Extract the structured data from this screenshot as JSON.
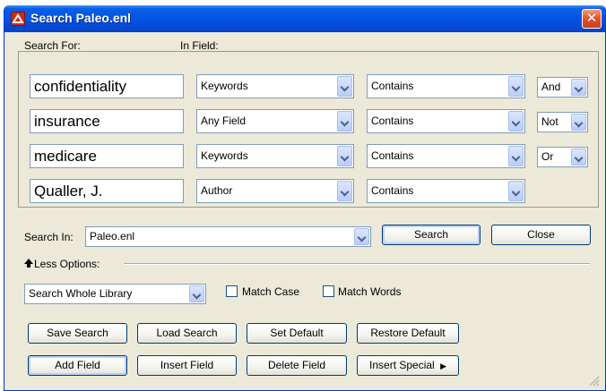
{
  "window": {
    "title": "Search Paleo.enl"
  },
  "headers": {
    "search_for": "Search For:",
    "in_field": "In Field:"
  },
  "rows": [
    {
      "term": "confidentiality",
      "field": "Keywords",
      "op": "Contains",
      "bool": "And"
    },
    {
      "term": "insurance",
      "field": "Any Field",
      "op": "Contains",
      "bool": "Not"
    },
    {
      "term": "medicare",
      "field": "Keywords",
      "op": "Contains",
      "bool": "Or"
    },
    {
      "term": "Qualler, J.",
      "field": "Author",
      "op": "Contains",
      "bool": ""
    }
  ],
  "search_in": {
    "label": "Search In:",
    "value": "Paleo.enl"
  },
  "actions": {
    "search": "Search",
    "close": "Close"
  },
  "options": {
    "toggle_label": "Less Options:",
    "scope": "Search Whole Library",
    "match_case": "Match Case",
    "match_words": "Match Words",
    "match_case_checked": false,
    "match_words_checked": false
  },
  "buttons": {
    "save_search": "Save Search",
    "load_search": "Load Search",
    "set_default": "Set Default",
    "restore_default": "Restore Default",
    "add_field": "Add Field",
    "insert_field": "Insert Field",
    "delete_field": "Delete Field",
    "insert_special": "Insert Special"
  },
  "icons": {
    "app": "endnote-app-icon",
    "close": "close-icon",
    "dropdown": "chevron-down-icon",
    "toggle": "triangle-up-icon",
    "submenu": "triangle-right-icon",
    "grip": "resize-grip-icon"
  },
  "colors": {
    "titlebar": "#0554e3",
    "face": "#ece9d8",
    "close_button": "#e0502a",
    "field_border": "#7f9db9"
  }
}
